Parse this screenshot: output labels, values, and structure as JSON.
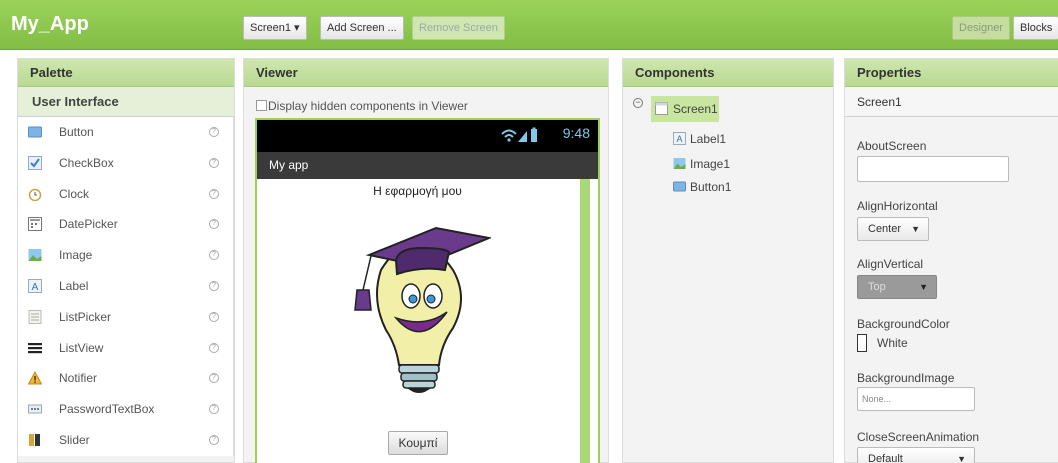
{
  "app": {
    "title": "My_App",
    "screen_select": "Screen1 ▾",
    "add_screen": "Add Screen ...",
    "remove_screen": "Remove Screen",
    "designer": "Designer",
    "blocks": "Blocks",
    "accent_color": "#8bc34a"
  },
  "palette": {
    "header": "Palette",
    "category": "User Interface",
    "items": [
      {
        "label": "Button",
        "icon": "button-icon"
      },
      {
        "label": "CheckBox",
        "icon": "checkbox-icon"
      },
      {
        "label": "Clock",
        "icon": "clock-icon"
      },
      {
        "label": "DatePicker",
        "icon": "datepicker-icon"
      },
      {
        "label": "Image",
        "icon": "image-icon"
      },
      {
        "label": "Label",
        "icon": "label-icon"
      },
      {
        "label": "ListPicker",
        "icon": "listpicker-icon"
      },
      {
        "label": "ListView",
        "icon": "listview-icon"
      },
      {
        "label": "Notifier",
        "icon": "notifier-icon"
      },
      {
        "label": "PasswordTextBox",
        "icon": "passwordtextbox-icon"
      },
      {
        "label": "Slider",
        "icon": "slider-icon"
      }
    ],
    "help_glyph": "?"
  },
  "viewer": {
    "header": "Viewer",
    "hidden_option": "Display hidden components in Viewer",
    "status_time": "9:48",
    "action_bar_title": "My app",
    "label_text": "Η εφαρμογή μου",
    "button_text": "Κουμπί"
  },
  "components": {
    "header": "Components",
    "toggle": "−",
    "root": "Screen1",
    "children": [
      "Label1",
      "Image1",
      "Button1"
    ]
  },
  "properties": {
    "header": "Properties",
    "component": "Screen1",
    "about_screen": "AboutScreen",
    "align_horizontal": "AlignHorizontal",
    "align_horizontal_value": "Center",
    "align_vertical": "AlignVertical",
    "align_vertical_value": "Top",
    "background_color": "BackgroundColor",
    "background_color_value": "White",
    "background_image": "BackgroundImage",
    "background_image_value": "None...",
    "close_screen_animation": "CloseScreenAnimation",
    "close_screen_animation_value": "Default"
  }
}
